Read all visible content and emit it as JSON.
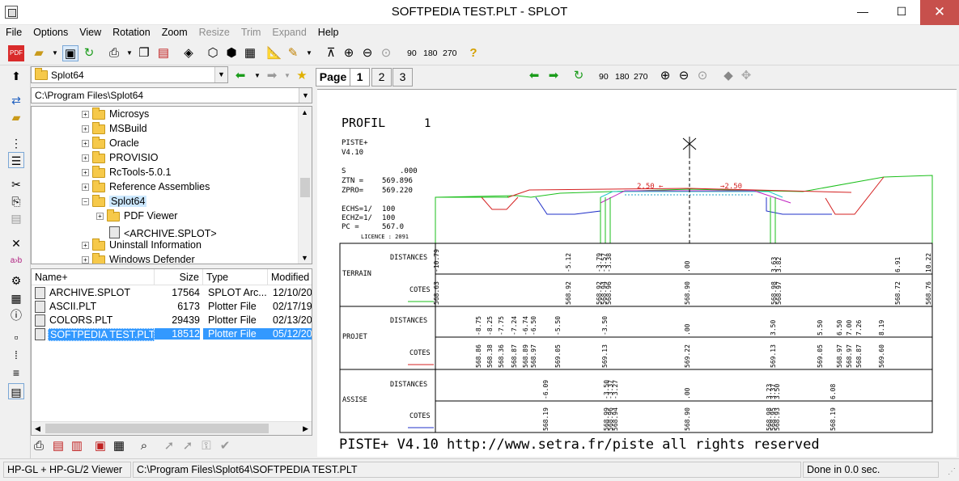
{
  "window": {
    "title": "SOFTPEDIA TEST.PLT - SPLOT",
    "minimize": "—",
    "maximize": "☐",
    "close": "✕"
  },
  "menu": [
    "File",
    "Options",
    "View",
    "Rotation",
    "Zoom",
    "Resize",
    "Trim",
    "Expand",
    "Help"
  ],
  "menu_disabled": [
    "Resize",
    "Trim",
    "Expand"
  ],
  "toolbar": {
    "rot90": "90",
    "rot180": "180",
    "rot270": "270"
  },
  "browser": {
    "folder": "Splot64",
    "path": "C:\\Program Files\\Splot64",
    "tree": [
      {
        "label": "Microsys"
      },
      {
        "label": "MSBuild"
      },
      {
        "label": "Oracle"
      },
      {
        "label": "PROVISIO"
      },
      {
        "label": "RcTools-5.0.1"
      },
      {
        "label": "Reference Assemblies"
      },
      {
        "label": "Splot64"
      },
      {
        "label": "PDF Viewer"
      },
      {
        "label": "<ARCHIVE.SPLOT>"
      },
      {
        "label": "Uninstall Information"
      },
      {
        "label": "Windows Defender"
      }
    ],
    "columns": [
      "Name",
      "Size",
      "Type",
      "Modified"
    ],
    "files": [
      {
        "name": "ARCHIVE.SPLOT",
        "size": "17564",
        "type": "SPLOT Arc...",
        "modified": "12/10/20"
      },
      {
        "name": "ASCII.PLT",
        "size": "6173",
        "type": "Plotter File",
        "modified": "02/17/19"
      },
      {
        "name": "COLORS.PLT",
        "size": "29439",
        "type": "Plotter File",
        "modified": "02/13/20"
      },
      {
        "name": "SOFTPEDIA TEST.PLT",
        "size": "18512",
        "type": "Plotter File",
        "modified": "05/12/20"
      }
    ]
  },
  "viewer": {
    "page_label": "Page",
    "pages": [
      "1",
      "2",
      "3"
    ],
    "rot90": "90",
    "rot180": "180",
    "rot270": "270"
  },
  "plot": {
    "title": "PROFIL",
    "number": "1",
    "program": "PISTE+",
    "version": "V4.10",
    "params": [
      {
        "k": "S",
        "v": ".000"
      },
      {
        "k": "ZTN =",
        "v": "569.896"
      },
      {
        "k": "ZPRO=",
        "v": "569.220"
      }
    ],
    "scales": [
      {
        "k": "ECHS=1/",
        "v": "100"
      },
      {
        "k": "ECHZ=1/",
        "v": "100"
      },
      {
        "k": "PC =",
        "v": "567.0"
      }
    ],
    "licence": "LICENCE : 2091",
    "slope_left": "2.50 ←",
    "slope_right": "→2.50",
    "groups": [
      {
        "name": "TERRAIN",
        "distances": "DISTANCES",
        "cotes": "COTES"
      },
      {
        "name": "PROJET",
        "distances": "DISTANCES",
        "cotes": "COTES"
      },
      {
        "name": "ASSISE",
        "distances": "DISTANCES",
        "cotes": "COTES"
      }
    ],
    "terrain_dist": [
      "-10.79",
      "-5.12",
      "-3.79",
      "-3.57",
      "-3.38",
      ".00",
      "3.63",
      "3.82",
      "6.91",
      "10.22"
    ],
    "terrain_cotes": [
      "568.63",
      "568.92",
      "568.92",
      "568.94",
      "568.96",
      "568.90",
      "568.98",
      "568.97",
      "568.72",
      "568.76"
    ],
    "projet_dist": [
      "-8.75",
      "-8.25",
      "-7.75",
      "-7.24",
      "-6.74",
      "-6.50",
      "-5.50",
      "-3.50",
      ".00",
      "3.50",
      "5.50",
      "6.50",
      "7.00",
      "7.26",
      "8.19"
    ],
    "projet_cotes": [
      "568.86",
      "568.38",
      "568.36",
      "568.87",
      "568.89",
      "568.97",
      "569.05",
      "569.13",
      "569.22",
      "569.13",
      "569.05",
      "568.97",
      "568.97",
      "568.87",
      "569.60"
    ],
    "assise_dist": [
      "-6.09",
      "-3.50",
      "-3.37",
      "-3.27",
      ".00",
      "3.23",
      "3.37",
      "3.50",
      "6.08"
    ],
    "assise_cotes": [
      "568.19",
      "568.99",
      "568.96",
      "568.94",
      "568.90",
      "568.98",
      "568.95",
      "568.93",
      "568.19"
    ],
    "footer": "PISTE+ V4.10 http://www.setra.fr/piste  all rights reserved"
  },
  "status": {
    "app": "HP-GL + HP-GL/2 Viewer",
    "file": "C:\\Program Files\\Splot64\\SOFTPEDIA TEST.PLT",
    "time": "Done in 0.0 sec."
  }
}
